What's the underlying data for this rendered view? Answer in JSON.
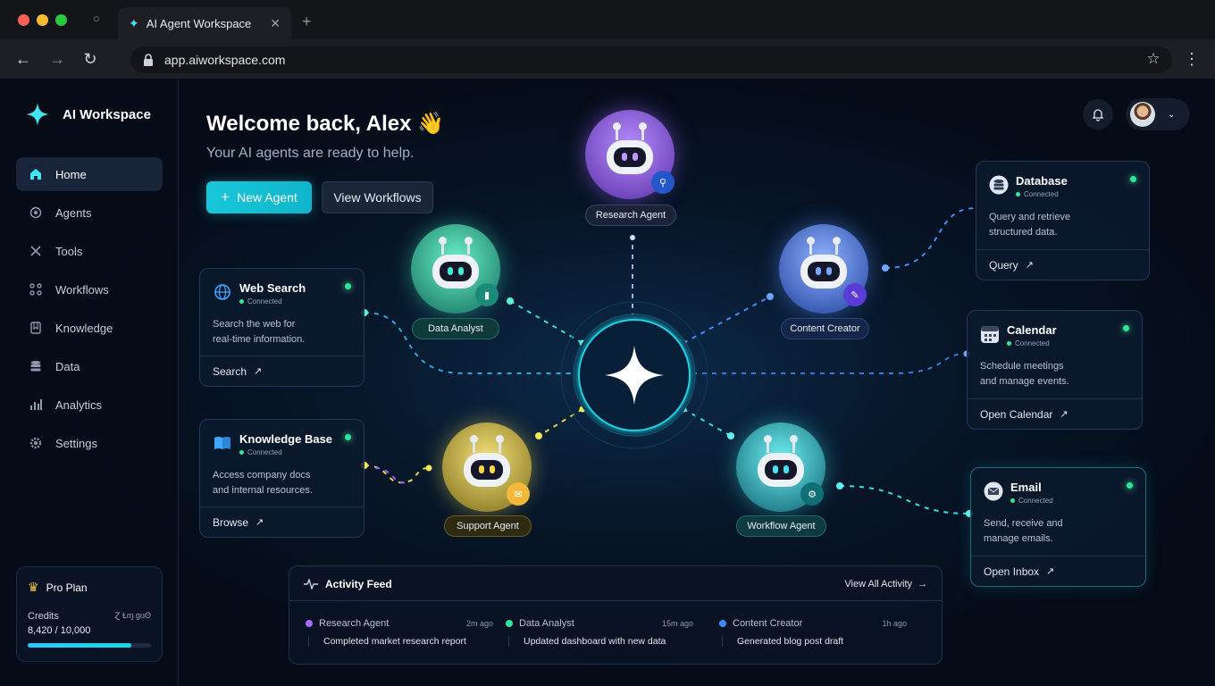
{
  "browser": {
    "tab_title": "AI Agent Workspace",
    "url": "app.aiworkspace.com"
  },
  "sidebar": {
    "brand": "AI Workspace",
    "items": [
      {
        "label": "Home",
        "icon": "home-icon"
      },
      {
        "label": "Agents",
        "icon": "gear-icon"
      },
      {
        "label": "Tools",
        "icon": "tools-icon"
      },
      {
        "label": "Workflows",
        "icon": "workflow-icon"
      },
      {
        "label": "Knowledge",
        "icon": "book-icon"
      },
      {
        "label": "Data",
        "icon": "database-icon"
      },
      {
        "label": "Analytics",
        "icon": "analytics-icon"
      },
      {
        "label": "Settings",
        "icon": "settings-icon"
      }
    ],
    "plan": {
      "name": "Pro Plan",
      "credits_label": "Credits",
      "credits_value": "8,420 / 10,000",
      "credits_fraction": 0.842,
      "credits_aside": "Ɀ Ɫɱ ɡʊʘ"
    }
  },
  "main": {
    "welcome": "Welcome back, Alex 👋",
    "subtitle": "Your AI agents are ready to help.",
    "new_agent": "New Agent",
    "view_workflows": "View Workflows"
  },
  "agents": {
    "research": "Research Agent",
    "data": "Data Analyst",
    "content": "Content Creator",
    "support": "Support Agent",
    "workflow": "Workflow Agent"
  },
  "tools": {
    "web": {
      "title": "Web Search",
      "status": "Connected",
      "desc1": "Search the web for",
      "desc2": "real-time information.",
      "action": "Search"
    },
    "kb": {
      "title": "Knowledge Base",
      "status": "Connected",
      "desc1": "Access company docs",
      "desc2": "and internal resources.",
      "action": "Browse"
    },
    "db": {
      "title": "Database",
      "status": "Connected",
      "desc1": "Query and retrieve",
      "desc2": "structured data.",
      "action": "Query"
    },
    "cal": {
      "title": "Calendar",
      "status": "Connected",
      "desc1": "Schedule meetings",
      "desc2": "and manage events.",
      "action": "Open Calendar"
    },
    "email": {
      "title": "Email",
      "status": "Connected",
      "desc1": "Send, receive and",
      "desc2": "manage emails.",
      "action": "Open Inbox"
    }
  },
  "feed": {
    "title": "Activity Feed",
    "view_all": "View All Activity",
    "items": [
      {
        "agent": "Research Agent",
        "time": "2m ago",
        "msg": "Completed market research report",
        "color": "#a66bff"
      },
      {
        "agent": "Data Analyst",
        "time": "15m ago",
        "msg": "Updated dashboard with new data",
        "color": "#2ee89a"
      },
      {
        "agent": "Content Creator",
        "time": "1h ago",
        "msg": "Generated blog post draft",
        "color": "#3d8bff"
      }
    ]
  }
}
